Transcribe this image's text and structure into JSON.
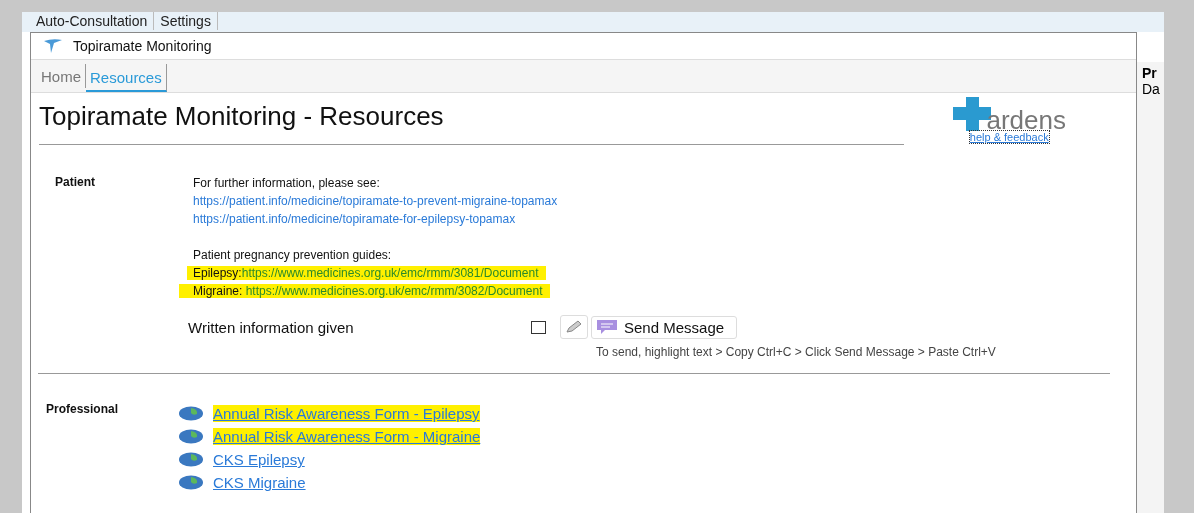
{
  "background_app": {
    "tabs": [
      {
        "label": "Auto-Consultation"
      },
      {
        "label": "Settings"
      }
    ],
    "side_panel": {
      "heading": "Pr",
      "text": "Da"
    }
  },
  "window": {
    "title": "Topiramate Monitoring"
  },
  "tabs": [
    {
      "label": "Home",
      "selected": false
    },
    {
      "label": "Resources",
      "selected": true
    }
  ],
  "page_title": "Topiramate Monitoring - Resources",
  "logo": {
    "wordmark": "ardens",
    "link": "help & feedback"
  },
  "patient": {
    "label": "Patient",
    "lines": [
      {
        "kind": "text",
        "text": "For further information, please see:",
        "highlighted": false
      },
      {
        "kind": "link",
        "text": "https://patient.info/medicine/topiramate-to-prevent-migraine-topamax",
        "highlighted": false
      },
      {
        "kind": "link",
        "text": "https://patient.info/medicine/topiramate-for-epilepsy-topamax",
        "highlighted": false
      },
      {
        "kind": "gap"
      },
      {
        "kind": "text",
        "text": "Patient pregnancy prevention guides:",
        "highlighted": false
      },
      {
        "kind": "labelled",
        "label": "Epilepsy:",
        "text": "https://www.medicines.org.uk/emc/rmm/3081/Document",
        "highlighted": true
      },
      {
        "kind": "labelled",
        "label": "Migraine: ",
        "text": "https://www.medicines.org.uk/emc/rmm/3082/Document",
        "highlighted": true
      }
    ],
    "written_info": {
      "label": "Written information given",
      "checked": false,
      "button": "Send Message",
      "hint": "To send, highlight text > Copy Ctrl+C > Click Send Message > Paste Ctrl+V"
    }
  },
  "professional": {
    "label": "Professional",
    "links": [
      {
        "text": "Annual Risk Awareness Form - Epilepsy",
        "highlighted": true
      },
      {
        "text": "Annual Risk Awareness Form - Migraine",
        "highlighted": true
      },
      {
        "text": "CKS Epilepsy",
        "highlighted": false
      },
      {
        "text": "CKS Migraine",
        "highlighted": false
      }
    ]
  }
}
